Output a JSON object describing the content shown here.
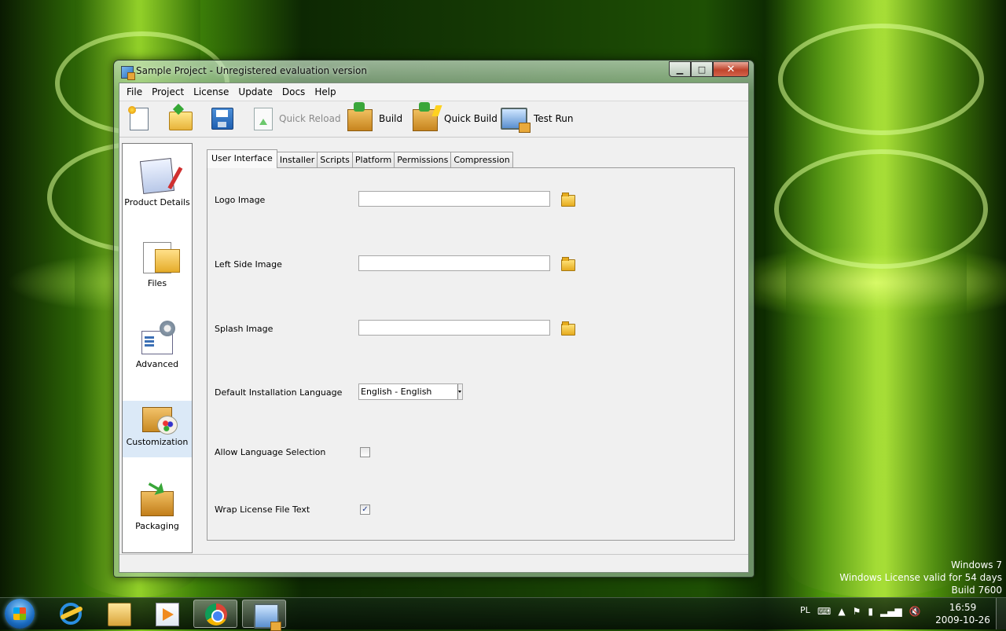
{
  "window": {
    "title": "Sample Project - Unregistered evaluation version",
    "controls": {
      "minimize": "▁",
      "maximize": "□",
      "close": "✕"
    }
  },
  "menu": [
    "File",
    "Project",
    "License",
    "Update",
    "Docs",
    "Help"
  ],
  "toolbar": {
    "new_icon": "new-document-icon",
    "open_icon": "open-folder-icon",
    "save_icon": "save-disk-icon",
    "quick_reload": "Quick Reload",
    "build": "Build",
    "quick_build": "Quick Build",
    "test_run": "Test Run"
  },
  "sidebar": {
    "selected": "Customization",
    "items": [
      {
        "label": "Product Details",
        "icon": "notepad-icon"
      },
      {
        "label": "Files",
        "icon": "files-icon"
      },
      {
        "label": "Advanced",
        "icon": "gears-icon"
      },
      {
        "label": "Customization",
        "icon": "palette-box-icon"
      },
      {
        "label": "Packaging",
        "icon": "package-icon"
      }
    ]
  },
  "tabs": {
    "active": "User Interface",
    "items": [
      "User Interface",
      "Installer",
      "Scripts",
      "Platform",
      "Permissions",
      "Compression"
    ]
  },
  "form": {
    "logo_label": "Logo Image",
    "logo_value": "",
    "left_side_label": "Left Side Image",
    "left_side_value": "",
    "splash_label": "Splash Image",
    "splash_value": "",
    "language_label": "Default Installation Language",
    "language_value": "English - English",
    "allow_language_label": "Allow Language Selection",
    "allow_language_checked": false,
    "wrap_license_label": "Wrap License File Text",
    "wrap_license_checked": true,
    "check_mark": "✓"
  },
  "desktop_watermark": {
    "line1": "Windows 7",
    "line2": "Windows License valid for 54 days",
    "line3": "Build 7600"
  },
  "taskbar": {
    "language": "PL",
    "tray_icons": [
      "keyboard-icon",
      "show-hidden-icons-arrow",
      "action-center-icon",
      "power-icon",
      "network-signal-icon",
      "volume-muted-icon"
    ],
    "time": "16:59",
    "date": "2009-10-26",
    "pinned": [
      "internet-explorer-icon",
      "windows-explorer-icon",
      "media-player-icon",
      "chrome-icon",
      "installer-app-icon"
    ]
  },
  "colors": {
    "window_frame": "#b0cfb0",
    "client_bg": "#f0f0f0",
    "sidebar_selected": "#dbe9f7",
    "close_button": "#c0452c"
  }
}
